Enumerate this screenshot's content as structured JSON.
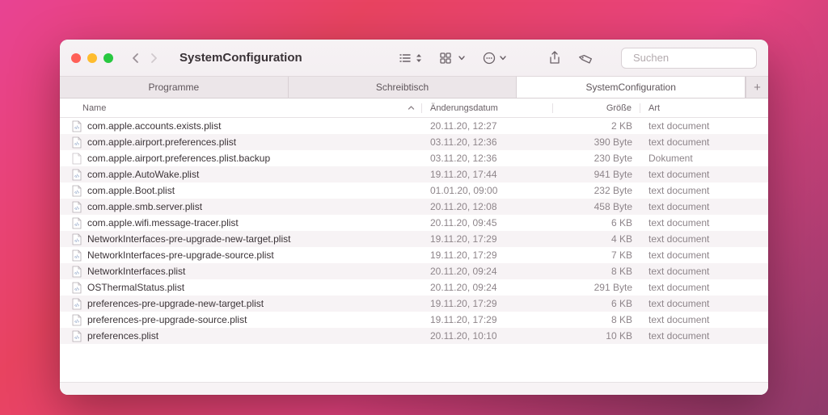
{
  "window": {
    "title": "SystemConfiguration"
  },
  "search": {
    "placeholder": "Suchen"
  },
  "tabs": [
    {
      "label": "Programme",
      "active": false
    },
    {
      "label": "Schreibtisch",
      "active": false
    },
    {
      "label": "SystemConfiguration",
      "active": true
    }
  ],
  "columns": {
    "name": "Name",
    "date": "Änderungsdatum",
    "size": "Größe",
    "kind": "Art"
  },
  "files": [
    {
      "name": "com.apple.accounts.exists.plist",
      "date": "20.11.20, 12:27",
      "size": "2 KB",
      "kind": "text document",
      "alt": false
    },
    {
      "name": "com.apple.airport.preferences.plist",
      "date": "03.11.20, 12:36",
      "size": "390 Byte",
      "kind": "text document",
      "alt": true
    },
    {
      "name": "com.apple.airport.preferences.plist.backup",
      "date": "03.11.20, 12:36",
      "size": "230 Byte",
      "kind": "Dokument",
      "alt": false
    },
    {
      "name": "com.apple.AutoWake.plist",
      "date": "19.11.20, 17:44",
      "size": "941 Byte",
      "kind": "text document",
      "alt": true
    },
    {
      "name": "com.apple.Boot.plist",
      "date": "01.01.20, 09:00",
      "size": "232 Byte",
      "kind": "text document",
      "alt": false
    },
    {
      "name": "com.apple.smb.server.plist",
      "date": "20.11.20, 12:08",
      "size": "458 Byte",
      "kind": "text document",
      "alt": true
    },
    {
      "name": "com.apple.wifi.message-tracer.plist",
      "date": "20.11.20, 09:45",
      "size": "6 KB",
      "kind": "text document",
      "alt": false
    },
    {
      "name": "NetworkInterfaces-pre-upgrade-new-target.plist",
      "date": "19.11.20, 17:29",
      "size": "4 KB",
      "kind": "text document",
      "alt": true
    },
    {
      "name": "NetworkInterfaces-pre-upgrade-source.plist",
      "date": "19.11.20, 17:29",
      "size": "7 KB",
      "kind": "text document",
      "alt": false
    },
    {
      "name": "NetworkInterfaces.plist",
      "date": "20.11.20, 09:24",
      "size": "8 KB",
      "kind": "text document",
      "alt": true
    },
    {
      "name": "OSThermalStatus.plist",
      "date": "20.11.20, 09:24",
      "size": "291 Byte",
      "kind": "text document",
      "alt": false
    },
    {
      "name": "preferences-pre-upgrade-new-target.plist",
      "date": "19.11.20, 17:29",
      "size": "6 KB",
      "kind": "text document",
      "alt": true
    },
    {
      "name": "preferences-pre-upgrade-source.plist",
      "date": "19.11.20, 17:29",
      "size": "8 KB",
      "kind": "text document",
      "alt": false
    },
    {
      "name": "preferences.plist",
      "date": "20.11.20, 10:10",
      "size": "10 KB",
      "kind": "text document",
      "alt": true
    }
  ]
}
